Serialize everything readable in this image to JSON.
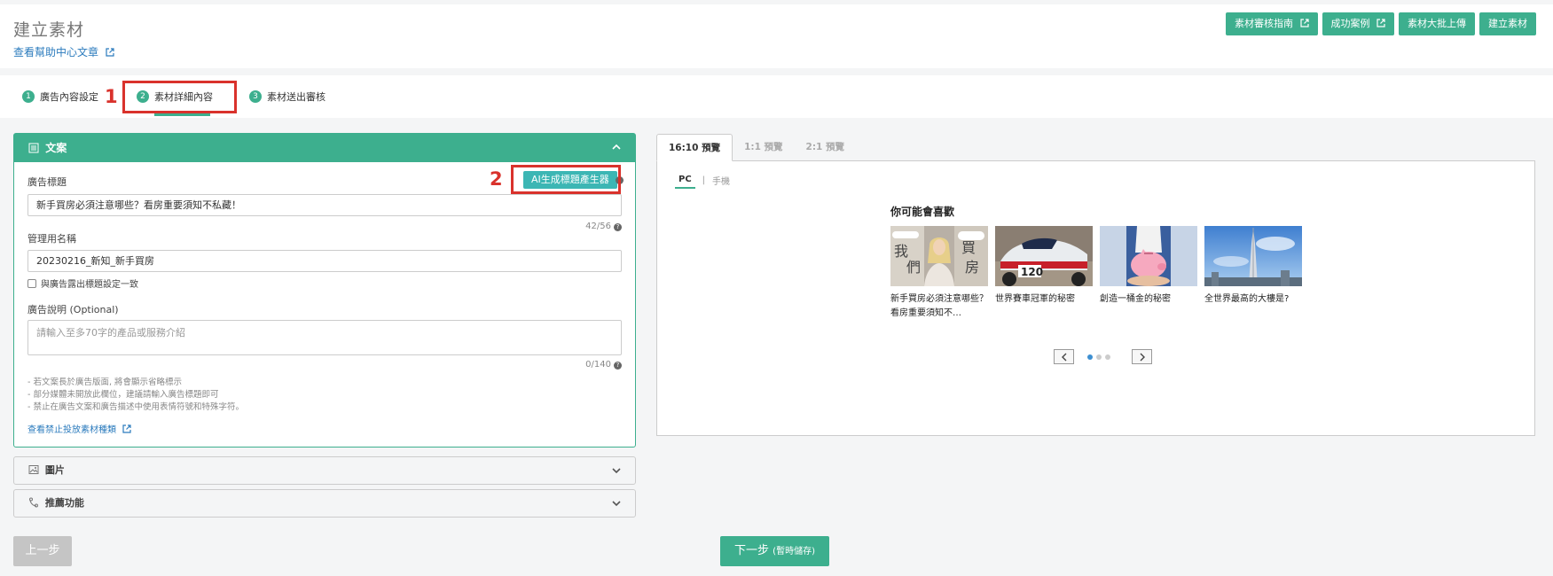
{
  "header": {
    "title": "建立素材",
    "help_link": "查看幫助中心文章",
    "buttons": [
      {
        "label": "素材審核指南",
        "external": true
      },
      {
        "label": "成功案例",
        "external": true
      },
      {
        "label": "素材大批上傳",
        "external": false
      },
      {
        "label": "建立素材",
        "external": false
      }
    ]
  },
  "stepper": {
    "steps": [
      {
        "num": "1",
        "label": "廣告內容設定"
      },
      {
        "num": "2",
        "label": "素材詳細內容"
      },
      {
        "num": "3",
        "label": "素材送出審核"
      }
    ],
    "active_step": 2
  },
  "annotations": {
    "one": "1",
    "two": "2"
  },
  "copy_panel": {
    "title": "文案",
    "ad_title_label": "廣告標題",
    "ai_button": "AI生成標題產生器",
    "ad_title_value": "新手買房必須注意哪些？看房重要須知不私藏！",
    "ad_title_counter": "42/56",
    "admin_name_label": "管理用名稱",
    "admin_name_value": "20230216_新知_新手買房",
    "same_as_title_label": "與廣告露出標題設定一致",
    "same_as_title_checked": false,
    "description_label": "廣告說明 (Optional)",
    "description_placeholder": "請輸入至多70字的產品或服務介紹",
    "description_counter": "0/140",
    "notes": [
      "- 若文案長於廣告版面, 將會顯示省略標示",
      "- 部分媒體未開放此欄位，建議請輸入廣告標題即可",
      "- 禁止在廣告文案和廣告描述中使用表情符號和特殊字符。"
    ],
    "forbidden_link": "查看禁止投放素材種類"
  },
  "image_panel": {
    "title": "圖片"
  },
  "tracking_panel": {
    "title": "推薦功能"
  },
  "footer": {
    "prev": "上一步",
    "next": "下一步",
    "next_sub": "(暫時儲存)"
  },
  "preview": {
    "tabs": [
      "16:10 預覽",
      "1:1 預覽",
      "2:1 預覽"
    ],
    "active_tab": 0,
    "sub_tabs": {
      "pc": "PC",
      "sep": "|",
      "mobile": "手機"
    },
    "heading": "你可能會喜歡",
    "cards": [
      {
        "title": "新手買房必須注意哪些？看房重要須知不…"
      },
      {
        "title": "世界賽車冠軍的秘密"
      },
      {
        "title": "創造一桶金的秘密"
      },
      {
        "title": "全世界最高的大樓是?"
      }
    ],
    "thumb_text": {
      "a": "我",
      "b": "們",
      "c": "買",
      "d": "房",
      "car_number": "120"
    },
    "page": 1,
    "page_count": 3
  },
  "colors": {
    "accent": "#3daf8e",
    "annotation": "#d9322c",
    "link": "#2b7bbd",
    "ai_button": "#3cb6b4"
  }
}
